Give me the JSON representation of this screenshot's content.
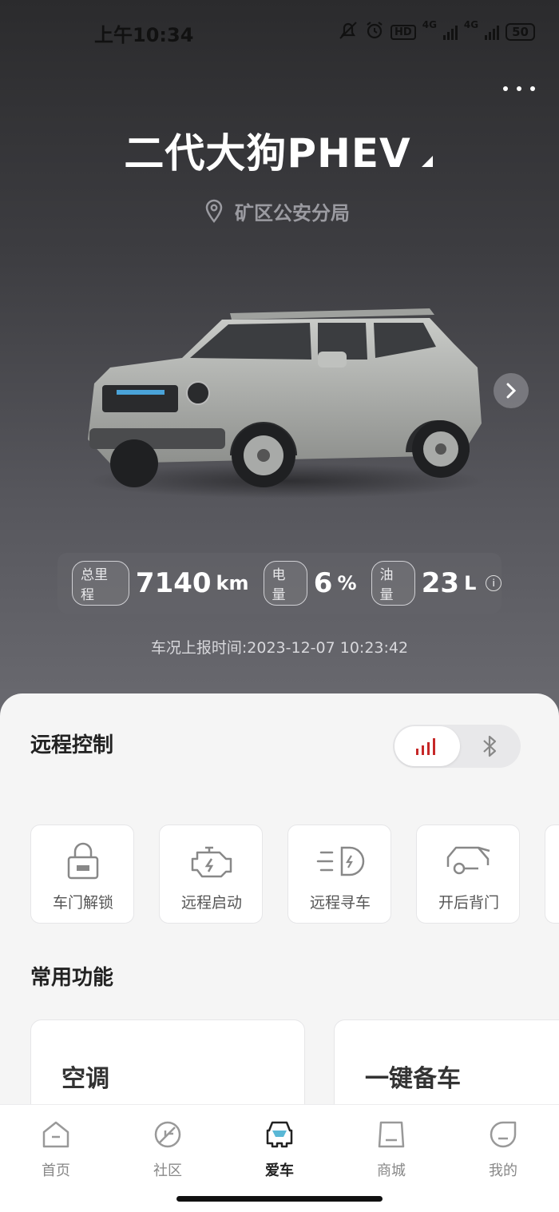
{
  "status_bar": {
    "time": "上午10:34",
    "network1": "4G",
    "network2": "4G",
    "hd": "HD",
    "battery": "50"
  },
  "header": {
    "car_name": "二代大狗PHEV",
    "location": "矿区公安分局"
  },
  "stats": {
    "mileage_label": "总里程",
    "mileage_value": "7140",
    "mileage_unit": "km",
    "battery_label": "电量",
    "battery_value": "6",
    "battery_unit": "%",
    "fuel_label": "油量",
    "fuel_value": "23",
    "fuel_unit": "L",
    "report_time": "车况上报时间:2023-12-07 10:23:42"
  },
  "remote": {
    "title": "远程控制",
    "controls": [
      {
        "label": "车门解锁",
        "icon": "lock-icon"
      },
      {
        "label": "远程启动",
        "icon": "engine-icon"
      },
      {
        "label": "远程寻车",
        "icon": "headlight-icon"
      },
      {
        "label": "开后背门",
        "icon": "tailgate-icon"
      }
    ]
  },
  "common": {
    "title": "常用功能",
    "cards": [
      {
        "label": "空调"
      },
      {
        "label": "一键备车"
      }
    ]
  },
  "tabs": [
    {
      "label": "首页",
      "icon": "home-icon"
    },
    {
      "label": "社区",
      "icon": "leaf-icon"
    },
    {
      "label": "爱车",
      "icon": "car-icon",
      "active": true
    },
    {
      "label": "商城",
      "icon": "shop-icon"
    },
    {
      "label": "我的",
      "icon": "profile-icon"
    }
  ],
  "colors": {
    "accent_red": "#c62828",
    "hero_dark": "#2b2b2d"
  }
}
